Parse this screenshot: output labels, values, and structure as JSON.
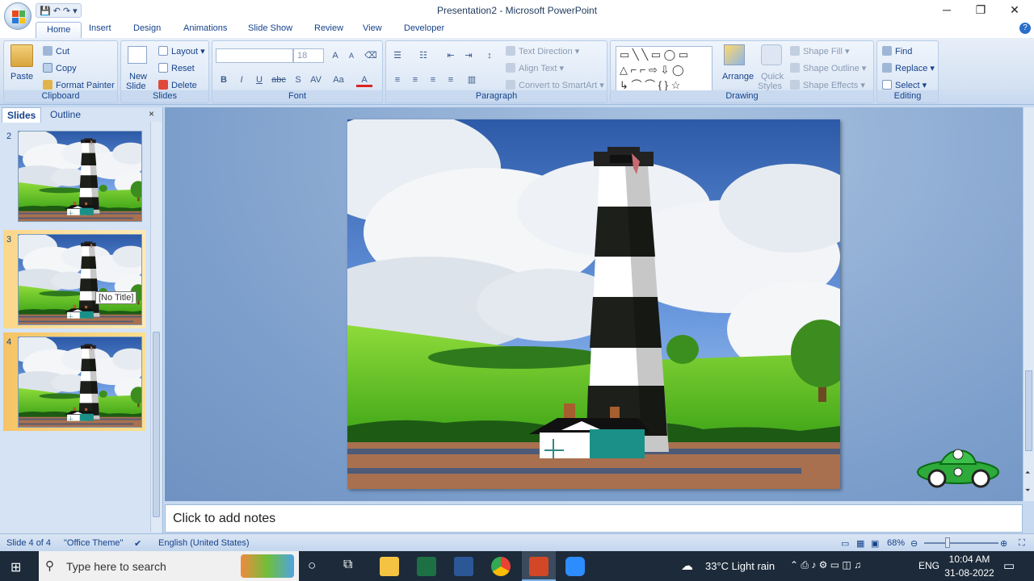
{
  "window": {
    "title": "Presentation2 - Microsoft PowerPoint",
    "minimize": "─",
    "restore": "❐",
    "close": "✕",
    "help": "?"
  },
  "qat": {
    "save": "💾",
    "undo": "↶",
    "redo": "↷",
    "more": "▾"
  },
  "tabs": [
    "Home",
    "Insert",
    "Design",
    "Animations",
    "Slide Show",
    "Review",
    "View",
    "Developer"
  ],
  "ribbon": {
    "clipboard": {
      "label": "Clipboard",
      "paste": "Paste",
      "cut": "Cut",
      "copy": "Copy",
      "format_painter": "Format Painter"
    },
    "slides": {
      "label": "Slides",
      "new_slide": "New",
      "new_slide2": "Slide",
      "layout": "Layout",
      "reset": "Reset",
      "delete": "Delete"
    },
    "font": {
      "label": "Font",
      "font_name": "",
      "font_size": "18",
      "grow": "A",
      "shrink": "A",
      "bold": "B",
      "italic": "I",
      "underline": "U",
      "strike": "abc",
      "shadow": "S",
      "spacing": "AV",
      "case": "Aa",
      "color": "A"
    },
    "paragraph": {
      "label": "Paragraph",
      "text_direction": "Text Direction",
      "align_text": "Align Text",
      "convert": "Convert to SmartArt"
    },
    "drawing": {
      "label": "Drawing",
      "arrange": "Arrange",
      "quick": "Quick",
      "styles": "Styles",
      "shape_fill": "Shape Fill",
      "shape_outline": "Shape Outline",
      "shape_effects": "Shape Effects"
    },
    "editing": {
      "label": "Editing",
      "find": "Find",
      "replace": "Replace",
      "select": "Select"
    }
  },
  "pane": {
    "tab_slides": "Slides",
    "tab_outline": "Outline",
    "close": "×",
    "slides": [
      {
        "num": "2"
      },
      {
        "num": "3"
      },
      {
        "num": "4"
      }
    ],
    "tooltip": "[No Title]"
  },
  "notes": {
    "placeholder": "Click to add notes"
  },
  "status": {
    "slide": "Slide 4 of 4",
    "theme": "\"Office Theme\"",
    "language": "English (United States)",
    "zoom": "68%"
  },
  "taskbar": {
    "search": "Type here to search",
    "weather": "33°C  Light rain",
    "lang": "ENG",
    "time": "10:04 AM",
    "date": "31-08-2022"
  }
}
